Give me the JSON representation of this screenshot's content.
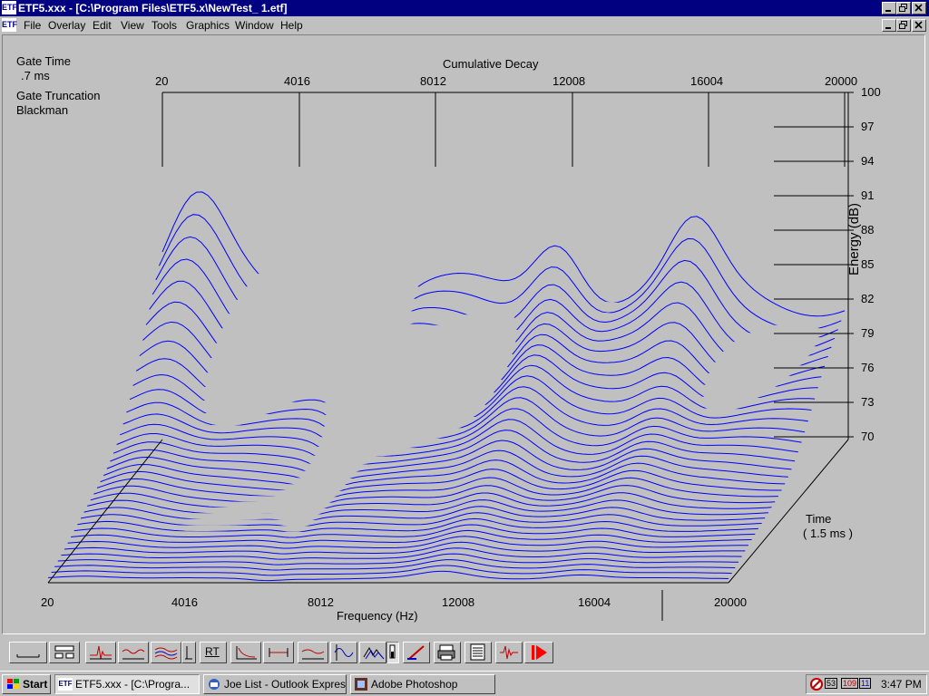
{
  "window": {
    "app_icon": "ETF",
    "title": "ETF5.xxx - [C:\\Program Files\\ETF5.x\\NewTest_ 1.etf]"
  },
  "menu": {
    "items": [
      "File",
      "Overlay",
      "Edit",
      "View",
      "Tools",
      "Graphics",
      "Window",
      "Help"
    ]
  },
  "plot": {
    "gate_time_label": "Gate Time",
    "gate_time_value": ".7 ms",
    "gate_trunc_label": "Gate Truncation",
    "gate_trunc_value": "Blackman",
    "title": "Cumulative Decay",
    "top_ticks": [
      "20",
      "4016",
      "8012",
      "12008",
      "16004",
      "20000"
    ],
    "bottom_ticks": [
      "20",
      "4016",
      "8012",
      "12008",
      "16004",
      "20000"
    ],
    "xlabel": "Frequency (Hz)",
    "ylabel": "Energy (dB)",
    "y_ticks": [
      "100",
      "97",
      "94",
      "91",
      "88",
      "85",
      "82",
      "79",
      "76",
      "73",
      "70"
    ],
    "time_label": "Time",
    "time_value": "( 1.5 ms )",
    "line_color": "#0000ff"
  },
  "chart_data": {
    "type": "waterfall",
    "title": "Cumulative Decay",
    "xlabel": "Frequency (Hz)",
    "ylabel": "Energy (dB)",
    "xlim": [
      20,
      20000
    ],
    "ylim": [
      70,
      100
    ],
    "z_label": "Time",
    "z_range_ms": 1.5
  },
  "toolbar": {
    "rt_label": "RT"
  },
  "taskbar": {
    "start_label": "Start",
    "buttons": [
      {
        "label": "ETF5.xxx - [C:\\Progra..."
      },
      {
        "label": "Joe List - Outlook Express"
      },
      {
        "label": "Adobe Photoshop"
      }
    ],
    "tray_nums": [
      "53",
      "109",
      "11"
    ],
    "clock": "3:47 PM"
  }
}
